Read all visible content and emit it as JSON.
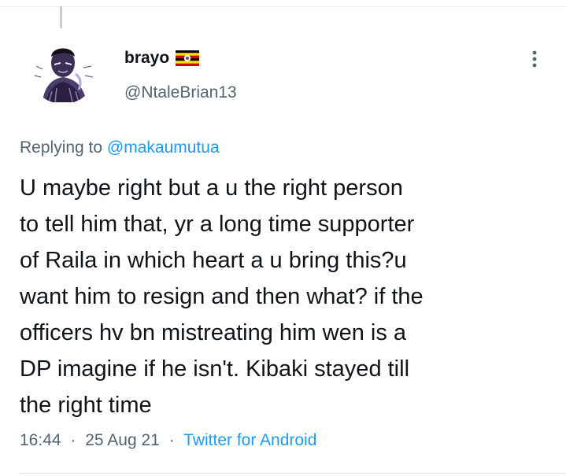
{
  "tweet": {
    "author": {
      "display_name": "brayo",
      "flag_icon": "uganda-flag-icon",
      "handle": "@NtaleBrian13"
    },
    "more_icon": "more-vertical-icon",
    "replying_prefix": "Replying to",
    "replying_to": "@makaumutua",
    "text_lines": [
      "U maybe right but a u the right person",
      "to tell him that, yr a long time supporter",
      "of Raila in which heart a u bring this?u",
      "want him to resign and then what? if the",
      "officers hv bn mistreating him wen is a",
      "DP imagine if he isn't. Kibaki stayed till",
      "the right time"
    ],
    "meta": {
      "time": "16:44",
      "separator": "·",
      "date": "25 Aug 21",
      "source": "Twitter for Android"
    }
  },
  "colors": {
    "text_primary": "#0f1419",
    "text_secondary": "#536471",
    "link": "#1d9bf0",
    "divider": "#e7ebee"
  }
}
